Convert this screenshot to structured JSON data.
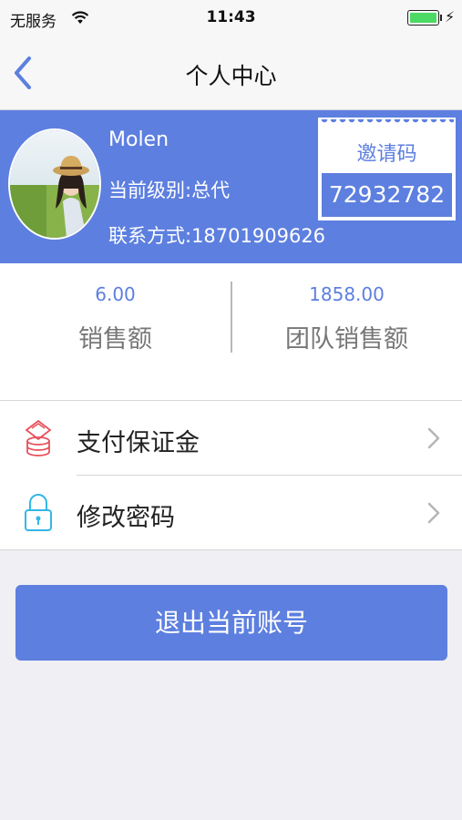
{
  "status_bar": {
    "carrier": "无服务",
    "time": "11:43"
  },
  "nav": {
    "title": "个人中心",
    "back_icon": "chevron-left-icon"
  },
  "profile": {
    "name": "Molen",
    "level": "当前级别:总代",
    "contact": "联系方式:18701909626",
    "invite_label": "邀请码",
    "invite_code": "72932782"
  },
  "stats": [
    {
      "value": "6.00",
      "label": "销售额"
    },
    {
      "value": "1858.00",
      "label": "团队销售额"
    }
  ],
  "menu": [
    {
      "label": "支付保证金",
      "icon": "coins-icon"
    },
    {
      "label": "修改密码",
      "icon": "lock-icon"
    }
  ],
  "logout_label": "退出当前账号",
  "colors": {
    "accent": "#5d7fdf",
    "coins_icon": "#e8505b",
    "lock_icon": "#35b6e6",
    "background": "#efeff4"
  }
}
